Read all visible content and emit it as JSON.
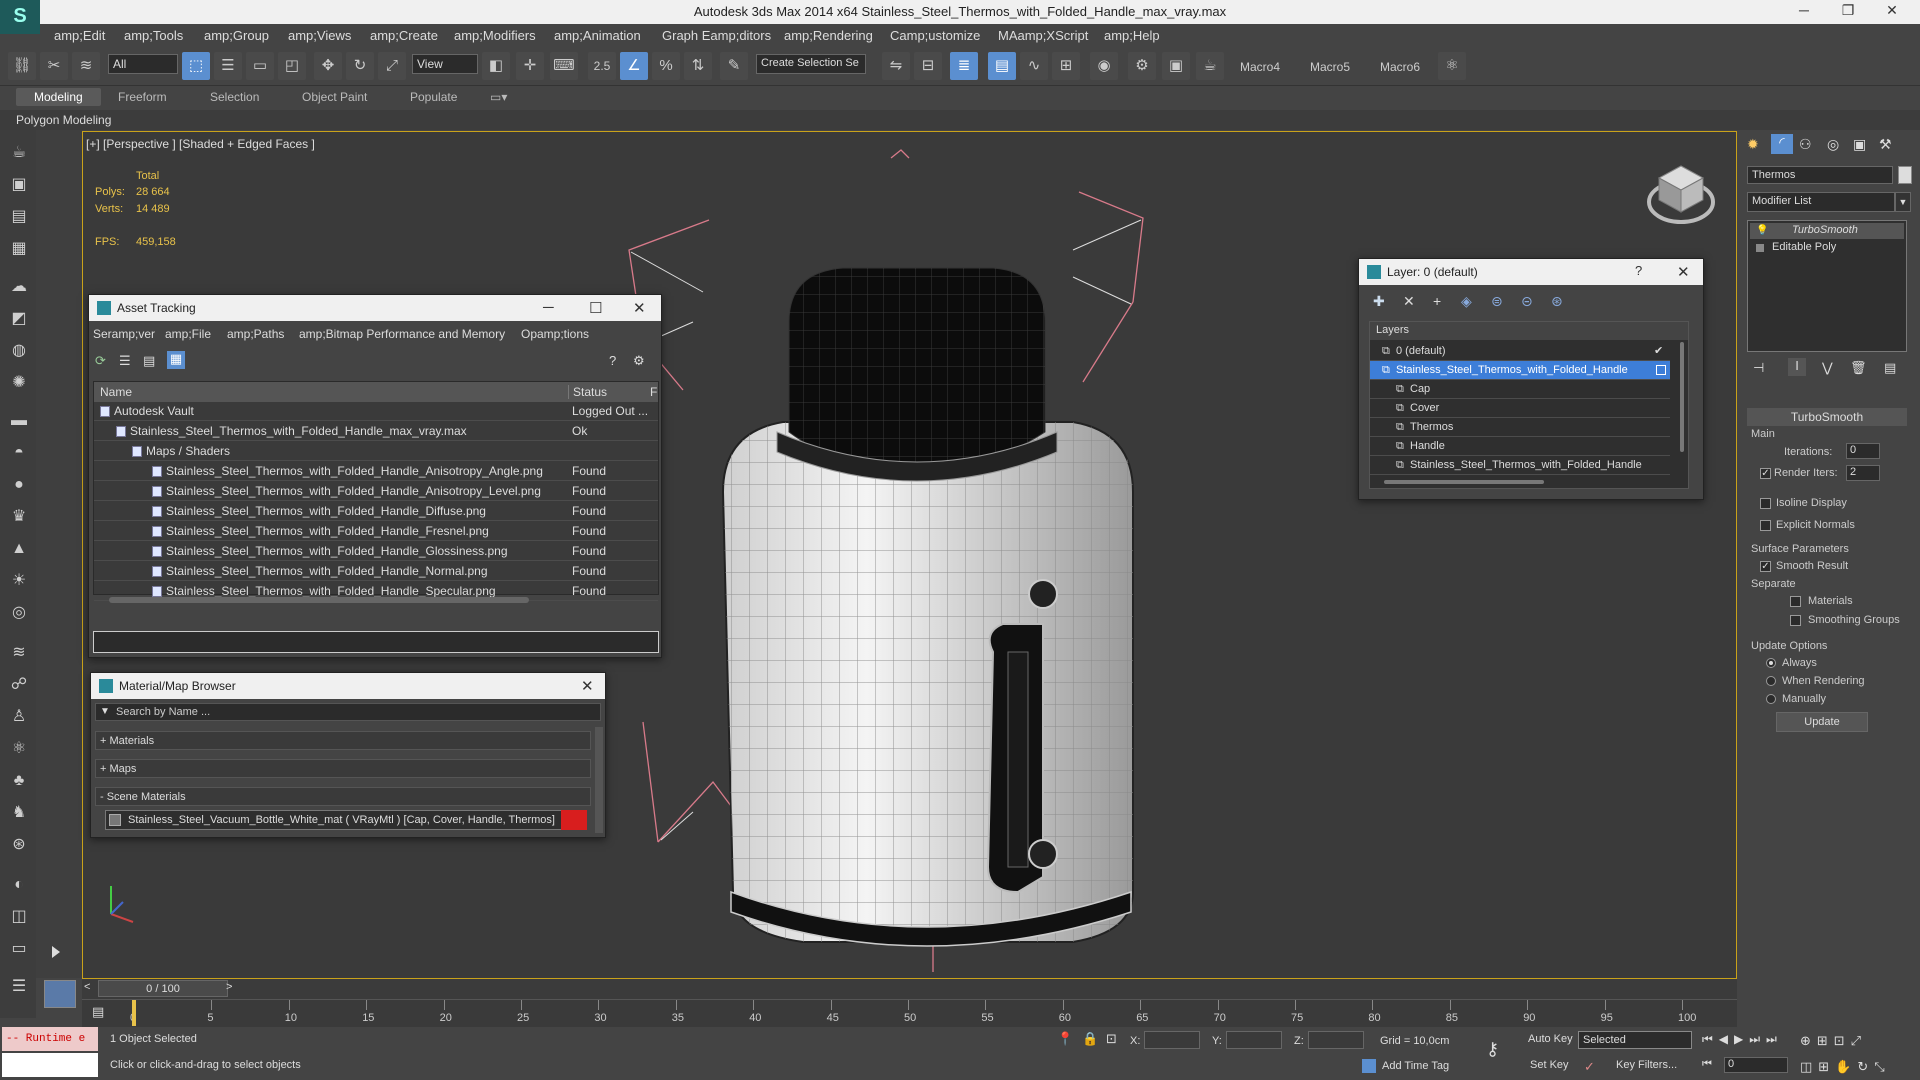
{
  "window": {
    "title": "Autodesk 3ds Max  2014 x64      Stainless_Steel_Thermos_with_Folded_Handle_max_vray.max",
    "minimize": "─",
    "maximize": "❐",
    "close": "✕"
  },
  "menu": [
    "amp;Edit",
    "amp;Tools",
    "amp;Group",
    "amp;Views",
    "amp;Create",
    "amp;Modifiers",
    "amp;Animation",
    "Graph Eamp;ditors",
    "amp;Rendering",
    "Camp;ustomize",
    "MAamp;XScript",
    "amp;Help"
  ],
  "toolbar": {
    "selection_filter": "All",
    "ref_coord": "View",
    "named_selection_placeholder": "Create Selection Se",
    "angle_snap_label": "2.5",
    "macros": [
      "Macro4",
      "Macro5",
      "Macro6"
    ]
  },
  "ribbon": {
    "tabs": [
      "Modeling",
      "Freeform",
      "Selection",
      "Object Paint",
      "Populate"
    ],
    "active": "Modeling",
    "sub_label": "Polygon Modeling"
  },
  "viewport": {
    "label": "[+] [Perspective ] [Shaded + Edged Faces ]",
    "stats": {
      "total_label": "Total",
      "polys_label": "Polys:",
      "polys": "28 664",
      "verts_label": "Verts:",
      "verts": "14 489",
      "fps_label": "FPS:",
      "fps": "459,158"
    }
  },
  "asset_tracking": {
    "title": "Asset Tracking",
    "menu": [
      "Seramp;ver",
      "amp;File",
      "amp;Paths",
      "amp;Bitmap Performance and Memory",
      "Opamp;tions"
    ],
    "columns": [
      "Name",
      "Status",
      "F"
    ],
    "rows": [
      {
        "name": "Autodesk Vault",
        "status": "Logged Out ..."
      },
      {
        "name": "Stainless_Steel_Thermos_with_Folded_Handle_max_vray.max",
        "status": "Ok"
      },
      {
        "name": "Maps / Shaders",
        "status": ""
      },
      {
        "name": "Stainless_Steel_Thermos_with_Folded_Handle_Anisotropy_Angle.png",
        "status": "Found"
      },
      {
        "name": "Stainless_Steel_Thermos_with_Folded_Handle_Anisotropy_Level.png",
        "status": "Found"
      },
      {
        "name": "Stainless_Steel_Thermos_with_Folded_Handle_Diffuse.png",
        "status": "Found"
      },
      {
        "name": "Stainless_Steel_Thermos_with_Folded_Handle_Fresnel.png",
        "status": "Found"
      },
      {
        "name": "Stainless_Steel_Thermos_with_Folded_Handle_Glossiness.png",
        "status": "Found"
      },
      {
        "name": "Stainless_Steel_Thermos_with_Folded_Handle_Normal.png",
        "status": "Found"
      },
      {
        "name": "Stainless_Steel_Thermos_with_Folded_Handle_Specular.png",
        "status": "Found"
      }
    ]
  },
  "material_browser": {
    "title": "Material/Map Browser",
    "search_placeholder": "Search by Name ...",
    "sections": [
      "+ Materials",
      "+ Maps",
      "- Scene Materials"
    ],
    "scene_material": "Stainless_Steel_Vacuum_Bottle_White_mat  ( VRayMtl ) [Cap, Cover, Handle, Thermos]"
  },
  "layer_dialog": {
    "title": "Layer: 0 (default)",
    "help": "?",
    "header": "Layers",
    "items": [
      "0 (default)",
      "Stainless_Steel_Thermos_with_Folded_Handle",
      "Cap",
      "Cover",
      "Thermos",
      "Handle",
      "Stainless_Steel_Thermos_with_Folded_Handle"
    ]
  },
  "command_panel": {
    "object_name": "Thermos",
    "modifier_list": "Modifier List",
    "stack": [
      "TurboSmooth",
      "Editable Poly"
    ],
    "rollout": "TurboSmooth",
    "main": "Main",
    "iterations_label": "Iterations:",
    "iterations": "0",
    "render_iters_label": "Render Iters:",
    "render_iters": "2",
    "isoline": "Isoline Display",
    "explicit_normals": "Explicit Normals",
    "surface_params": "Surface Parameters",
    "smooth_result": "Smooth Result",
    "separate": "Separate",
    "materials": "Materials",
    "smoothing_groups": "Smoothing Groups",
    "update_options": "Update Options",
    "always": "Always",
    "when_rendering": "When Rendering",
    "manually": "Manually",
    "update_button": "Update"
  },
  "timeline": {
    "frame": "0 / 100",
    "ticks": [
      "0",
      "5",
      "10",
      "15",
      "20",
      "25",
      "30",
      "35",
      "40",
      "45",
      "50",
      "55",
      "60",
      "65",
      "70",
      "75",
      "80",
      "85",
      "90",
      "95",
      "100"
    ]
  },
  "status": {
    "maxscript": "-- Runtime e",
    "selected": "1 Object Selected",
    "prompt": "Click or click-and-drag to select objects",
    "x_label": "X:",
    "y_label": "Y:",
    "z_label": "Z:",
    "grid": "Grid = 10,0cm",
    "auto_key": "Auto Key",
    "set_key": "Set Key",
    "selected_dropdown": "Selected",
    "key_filters": "Key Filters...",
    "add_time_tag": "Add Time Tag",
    "frame_field": "0"
  },
  "colors": {
    "accent_selection": "#5b8fd0",
    "viewport_border": "#c9a21a",
    "stats_text": "#e8c24a",
    "layer_highlight": "#3d7ed8"
  }
}
